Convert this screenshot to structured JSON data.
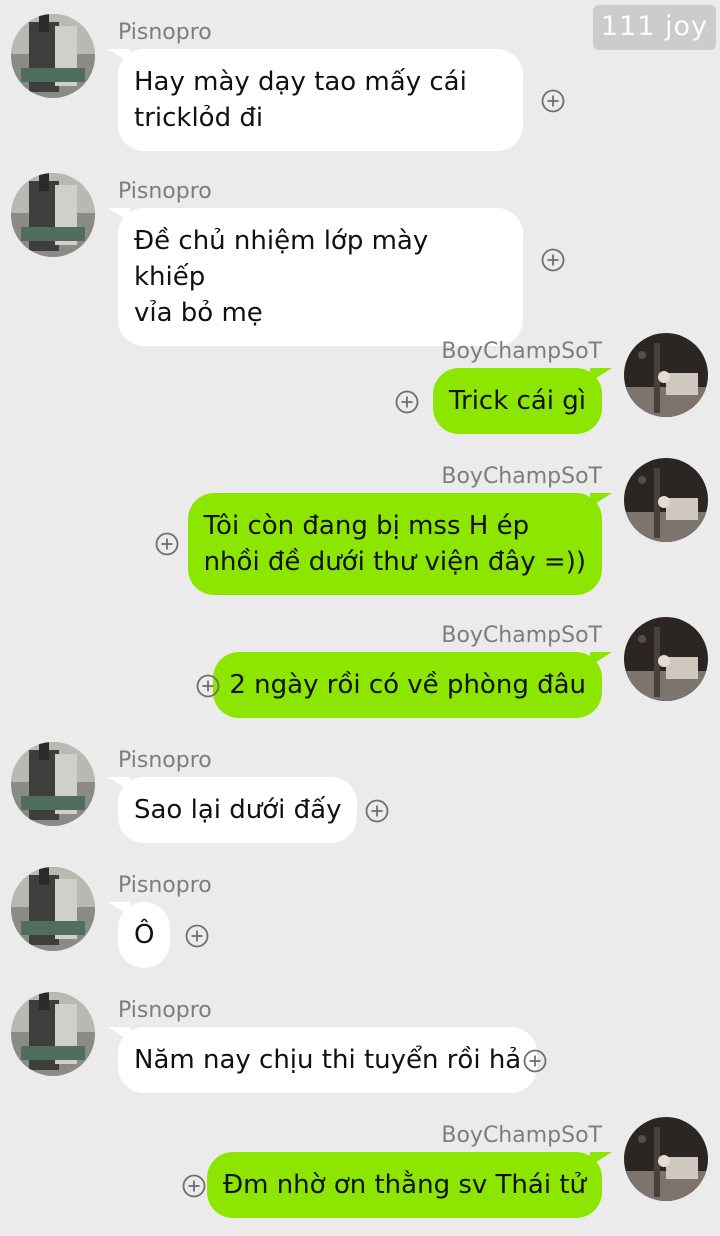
{
  "watermark": "111 joy",
  "colors": {
    "background": "#ebebeb",
    "received_bubble": "#ffffff",
    "sent_bubble": "#8ce600",
    "sender_name": "#7d7d7d"
  },
  "icons": {
    "reaction": "add-reaction-icon",
    "avatar_received": "avatar-pisnopro",
    "avatar_sent": "avatar-boychampsot"
  },
  "messages": [
    {
      "direction": "received",
      "sender": "Pisnopro",
      "text": "Hay mày dạy tao mấy cái\ntricklỏd đi"
    },
    {
      "direction": "received",
      "sender": "Pisnopro",
      "text": "Đề chủ nhiệm lớp mày khiếp\nvỉa bỏ mẹ"
    },
    {
      "direction": "sent",
      "sender": "BoyChampSoT",
      "text": "Trick cái gì"
    },
    {
      "direction": "sent",
      "sender": "BoyChampSoT",
      "text": "Tôi còn đang bị mss H ép\nnhồi đề dưới thư viện đây =))"
    },
    {
      "direction": "sent",
      "sender": "BoyChampSoT",
      "text": "2 ngày rồi có về phòng đâu"
    },
    {
      "direction": "received",
      "sender": "Pisnopro",
      "text": "Sao lại dưới đấy"
    },
    {
      "direction": "received",
      "sender": "Pisnopro",
      "text": "Ô"
    },
    {
      "direction": "received",
      "sender": "Pisnopro",
      "text": "Năm nay chịu thi tuyển rồi hả"
    },
    {
      "direction": "sent",
      "sender": "BoyChampSoT",
      "text": "Đm nhờ ơn thằng sv Thái tử"
    }
  ]
}
